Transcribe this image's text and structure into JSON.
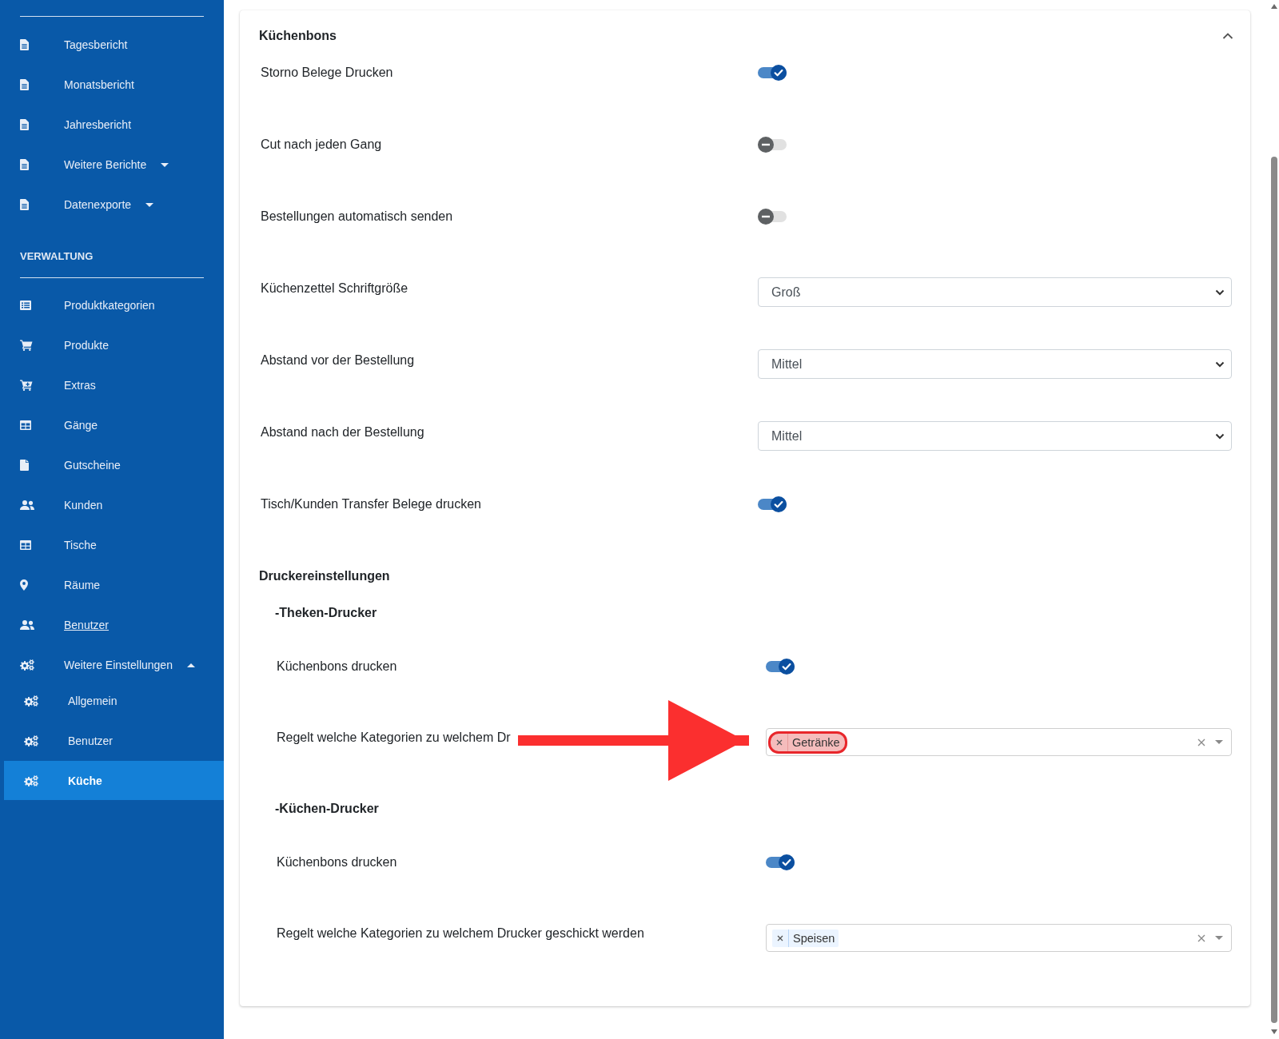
{
  "sidebar": {
    "groups": [
      {
        "items": [
          {
            "kind": "link",
            "label": "Tagesbericht",
            "selected": false,
            "hovered": false
          },
          {
            "kind": "link",
            "label": "Monatsbericht",
            "selected": false,
            "hovered": false
          },
          {
            "kind": "link",
            "label": "Jahresbericht",
            "selected": false,
            "hovered": false
          },
          {
            "kind": "dropdown",
            "label": "Weitere Berichte",
            "expanded": false,
            "selected": false,
            "hovered": false
          },
          {
            "kind": "dropdown",
            "label": "Datenexporte",
            "expanded": false,
            "selected": false,
            "hovered": false
          }
        ]
      },
      {
        "heading": "VERWALTUNG",
        "items": [
          {
            "kind": "link",
            "label": "Produktkategorien",
            "selected": false,
            "hovered": false
          },
          {
            "kind": "link",
            "label": "Produkte",
            "selected": false,
            "hovered": false
          },
          {
            "kind": "link",
            "label": "Extras",
            "selected": false,
            "hovered": false
          },
          {
            "kind": "link",
            "label": "Gänge",
            "selected": false,
            "hovered": false
          },
          {
            "kind": "link",
            "label": "Gutscheine",
            "selected": false,
            "hovered": false
          },
          {
            "kind": "link",
            "label": "Kunden",
            "selected": false,
            "hovered": false
          },
          {
            "kind": "link",
            "label": "Tische",
            "selected": false,
            "hovered": false
          },
          {
            "kind": "link",
            "label": "Räume",
            "selected": false,
            "hovered": false
          },
          {
            "kind": "link",
            "label": "Benutzer",
            "selected": false,
            "hovered": true
          },
          {
            "kind": "dropdown",
            "label": "Weitere Einstellungen",
            "expanded": true,
            "selected": false,
            "hovered": false,
            "children": [
              {
                "kind": "link",
                "label": "Allgemein",
                "selected": false,
                "hovered": false
              },
              {
                "kind": "link",
                "label": "Benutzer",
                "selected": false,
                "hovered": false
              },
              {
                "kind": "link",
                "label": "Küche",
                "selected": true,
                "hovered": false
              }
            ]
          }
        ]
      }
    ]
  },
  "panel": {
    "title": "Küchenbons",
    "expanded": true,
    "rows": [
      {
        "kind": "toggle",
        "label": "Storno Belege Drucken",
        "on": true
      },
      {
        "kind": "toggle",
        "label": "Cut nach jeden Gang",
        "on": false
      },
      {
        "kind": "toggle",
        "label": "Bestellungen automatisch senden",
        "on": false
      },
      {
        "kind": "select",
        "label": "Küchenzettel Schriftgröße",
        "value": "Groß"
      },
      {
        "kind": "select",
        "label": "Abstand vor der Bestellung",
        "value": "Mittel"
      },
      {
        "kind": "select",
        "label": "Abstand nach der Bestellung",
        "value": "Mittel"
      },
      {
        "kind": "toggle",
        "label": "Tisch/Kunden Transfer Belege drucken",
        "on": true
      }
    ],
    "printer_settings": {
      "title": "Druckereinstellungen",
      "printers": [
        {
          "title": "-Theken-Drucker",
          "rows": [
            {
              "kind": "toggle",
              "label": "Küchenbons drucken",
              "on": true
            },
            {
              "kind": "multiselect",
              "label": "Regelt welche Kategorien zu welchem Dr",
              "annotated": true,
              "tags": [
                {
                  "label": "Getränke",
                  "highlighted": true
                }
              ]
            }
          ]
        },
        {
          "title": "-Küchen-Drucker",
          "rows": [
            {
              "kind": "toggle",
              "label": "Küchenbons drucken",
              "on": true
            },
            {
              "kind": "multiselect",
              "label": "Regelt welche Kategorien zu welchem Drucker geschickt werden",
              "annotated": false,
              "tags": [
                {
                  "label": "Speisen",
                  "highlighted": false
                }
              ]
            }
          ]
        }
      ]
    }
  }
}
